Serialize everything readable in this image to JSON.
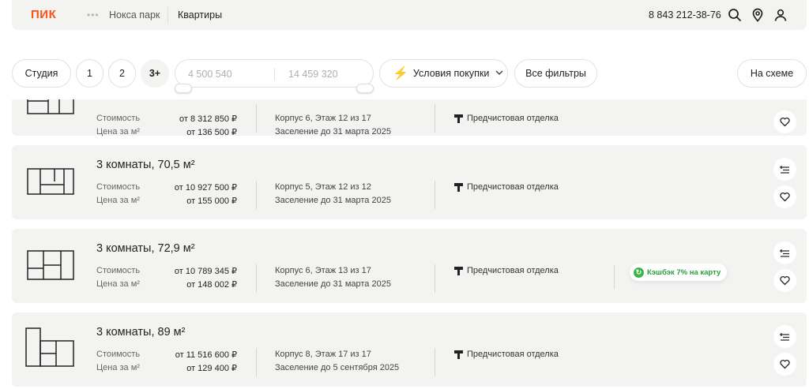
{
  "header": {
    "logo": "ПИК",
    "dots": "•••",
    "project": "Нокса парк",
    "section": "Квартиры",
    "phone": "8 843 212-38-76",
    "icons": [
      "search-icon",
      "location-pin-icon",
      "user-icon"
    ]
  },
  "filters": {
    "rooms": [
      "Студия",
      "1",
      "2",
      "3+"
    ],
    "active_room": "3+",
    "price_from_placeholder": "4 500 540",
    "price_to_placeholder": "14 459 320",
    "buy_terms": "Условия покупки",
    "all_filters": "Все фильтры",
    "on_scheme": "На схеме"
  },
  "accent_color": "#ff4f12",
  "listings": [
    {
      "title": "",
      "cost_label": "Стоимость",
      "cost": "от 8 312 850 ₽",
      "per_m2_label": "Цена за м²",
      "per_m2": "от 136 500 ₽",
      "building": "Корпус 6, Этаж 12 из 17",
      "settlement": "Заселение до 31 марта 2025",
      "finish": "Предчистовая отделка",
      "cashback": ""
    },
    {
      "title": "3 комнаты, 70,5 м²",
      "cost_label": "Стоимость",
      "cost": "от 10 927 500 ₽",
      "per_m2_label": "Цена за м²",
      "per_m2": "от 155 000 ₽",
      "building": "Корпус 5, Этаж 12 из 12",
      "settlement": "Заселение до 31 марта 2025",
      "finish": "Предчистовая отделка",
      "cashback": ""
    },
    {
      "title": "3 комнаты, 72,9 м²",
      "cost_label": "Стоимость",
      "cost": "от 10 789 345 ₽",
      "per_m2_label": "Цена за м²",
      "per_m2": "от 148 002 ₽",
      "building": "Корпус 6, Этаж 13 из 17",
      "settlement": "Заселение до 31 марта 2025",
      "finish": "Предчистовая отделка",
      "cashback": "Кэшбэк 7% на карту"
    },
    {
      "title": "3 комнаты, 89 м²",
      "cost_label": "Стоимость",
      "cost": "от 11 516 600 ₽",
      "per_m2_label": "Цена за м²",
      "per_m2": "от 129 400 ₽",
      "building": "Корпус 8, Этаж 17 из 17",
      "settlement": "Заселение до 5 сентября 2025",
      "finish": "Предчистовая отделка",
      "cashback": ""
    }
  ]
}
